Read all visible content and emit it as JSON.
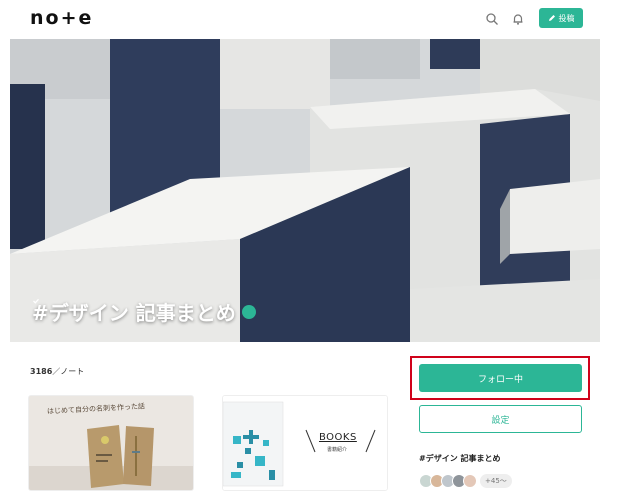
{
  "header": {
    "logo": "no+e",
    "post_label": "投稿",
    "icons": [
      "search-icon",
      "bell-icon",
      "pencil-icon"
    ]
  },
  "hero": {
    "title": "#デザイン 記事まとめ"
  },
  "magazine": {
    "count": "3186",
    "count_unit": "ノート",
    "cards": [
      {
        "text": "はじめて自分の名刺を作った話"
      },
      {
        "title": "BOOKS",
        "subtitle": "書籍紹介"
      }
    ]
  },
  "sidebar": {
    "follow_label": "フォロー中",
    "settings_label": "設定",
    "magazine_name": "#デザイン 記事まとめ",
    "followers_more": "+45〜"
  },
  "colors": {
    "accent": "#2cb696",
    "highlight": "#d0021b"
  }
}
